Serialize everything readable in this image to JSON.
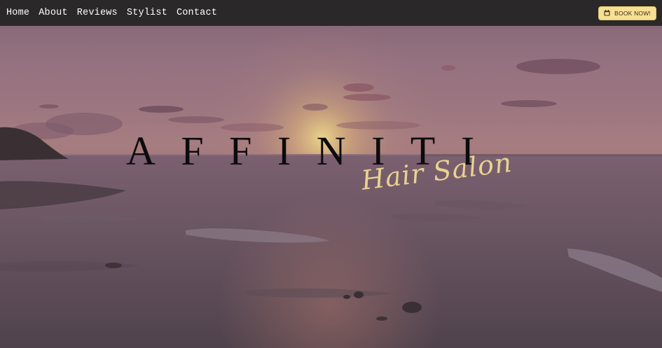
{
  "nav": {
    "links": [
      "Home",
      "About",
      "Reviews",
      "Stylist",
      "Contact"
    ],
    "book_label": "BOOK NOW!",
    "book_icon": "calendar-icon"
  },
  "hero": {
    "title": "AFFINITI",
    "subtitle": "Hair Salon",
    "background": "sunset-over-ocean"
  },
  "colors": {
    "nav_bg": "#2b2829",
    "accent": "#f7df93",
    "subtitle": "#e9d28f",
    "title": "#0d0b0c"
  }
}
